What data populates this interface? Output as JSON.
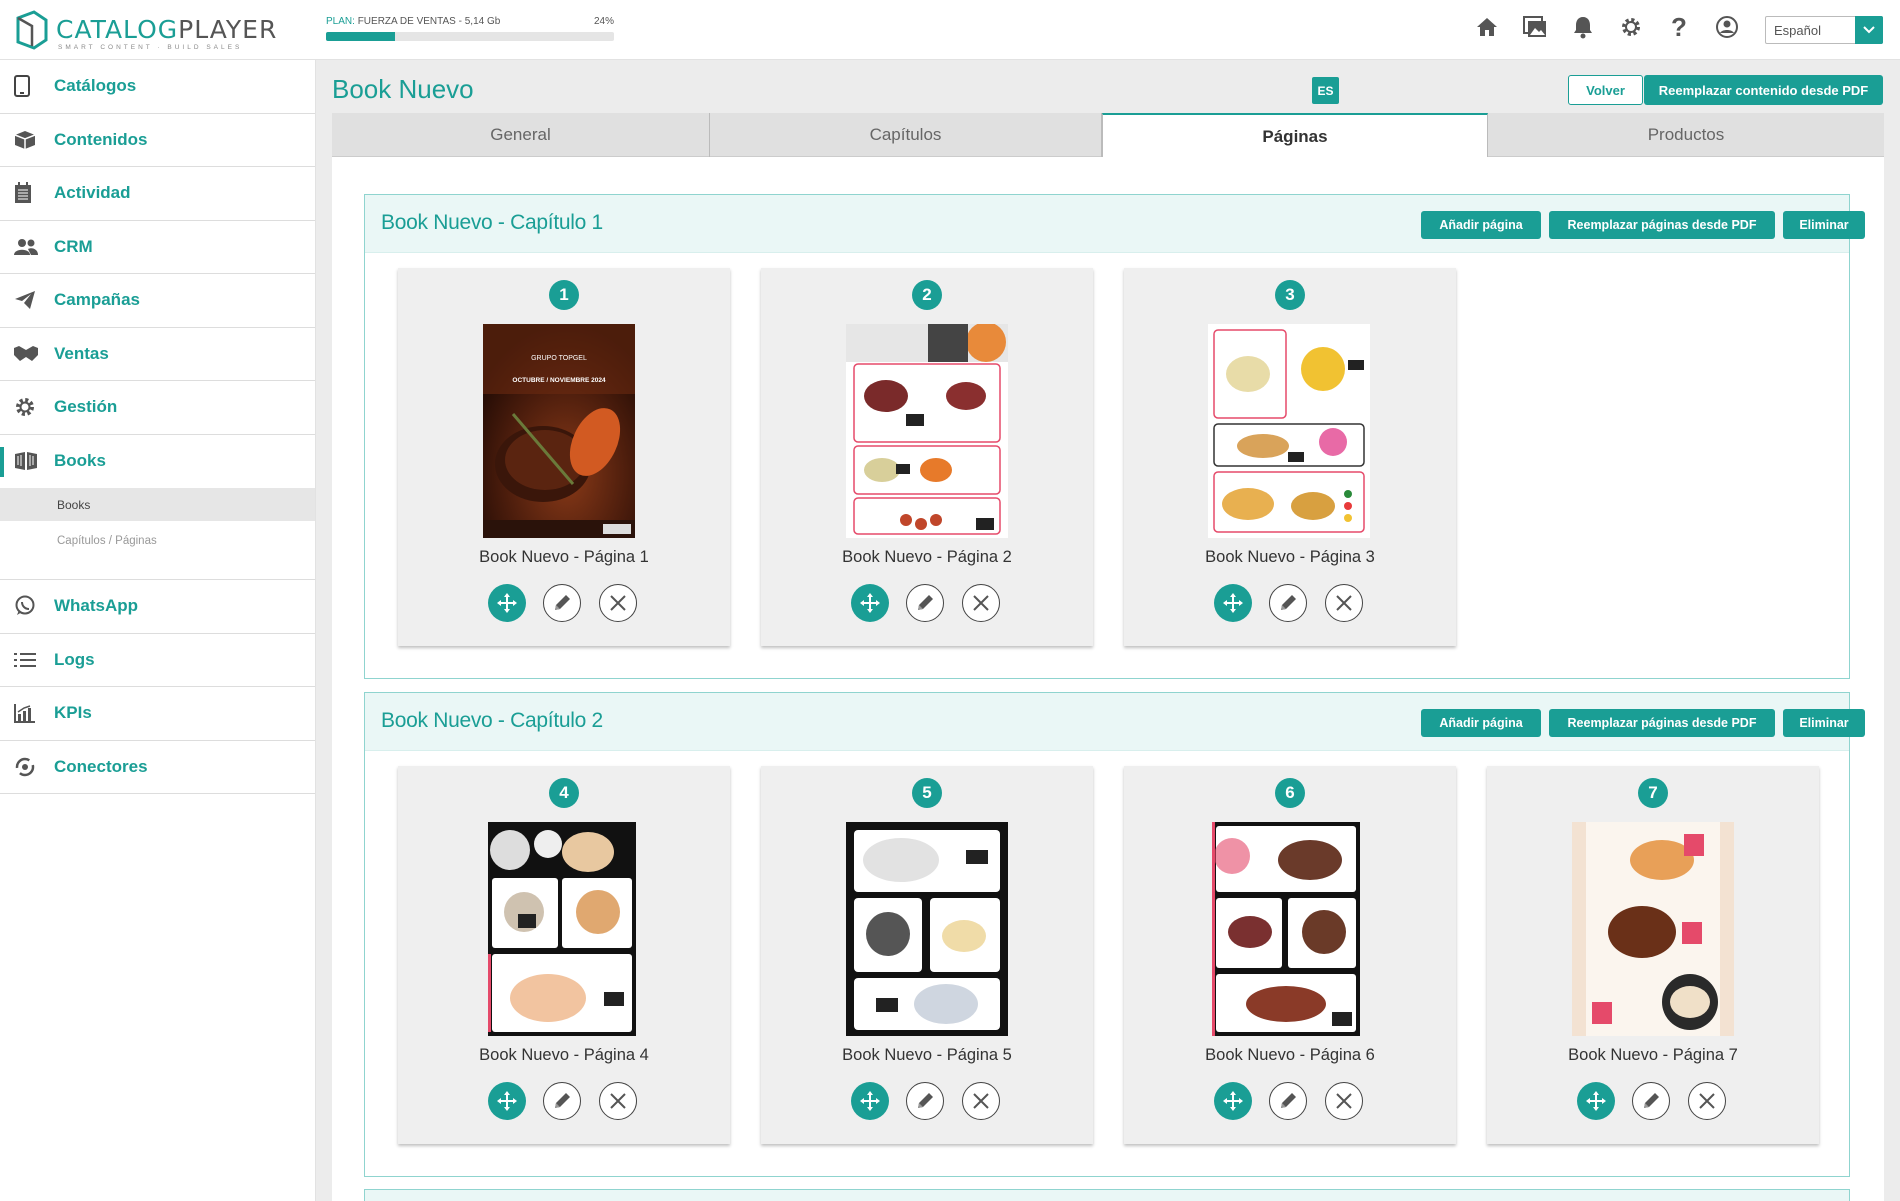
{
  "header": {
    "logo_main": "CATALOG",
    "logo_light": "PLAYER",
    "logo_tagline": "SMART CONTENT · BUILD SALES",
    "plan_prefix": "PLAN:",
    "plan_label": "FUERZA DE VENTAS - 5,14 Gb",
    "plan_percent_label": "24%",
    "plan_percent": 0.24,
    "icons": [
      "home-icon",
      "images-icon",
      "bell-icon",
      "gear-icon",
      "help-icon",
      "user-icon"
    ],
    "language": "Español"
  },
  "sidebar": {
    "items": [
      {
        "label": "Catálogos",
        "icon": "tablet-icon"
      },
      {
        "label": "Contenidos",
        "icon": "boxes-icon"
      },
      {
        "label": "Actividad",
        "icon": "calendar-icon"
      },
      {
        "label": "CRM",
        "icon": "users-icon"
      },
      {
        "label": "Campañas",
        "icon": "paper-plane-icon"
      },
      {
        "label": "Ventas",
        "icon": "handshake-icon"
      },
      {
        "label": "Gestión",
        "icon": "cog-icon"
      },
      {
        "label": "Books",
        "icon": "book-open-icon"
      }
    ],
    "sub_items": [
      "Books",
      "Capítulos / Páginas"
    ],
    "items_after": [
      {
        "label": "WhatsApp",
        "icon": "whatsapp-icon"
      },
      {
        "label": "Logs",
        "icon": "list-icon"
      },
      {
        "label": "KPIs",
        "icon": "chart-icon"
      },
      {
        "label": "Conectores",
        "icon": "connector-icon"
      }
    ]
  },
  "main": {
    "title": "Book Nuevo",
    "lang_badge": "ES",
    "back_label": "Volver",
    "replace_all_label": "Reemplazar contenido desde PDF",
    "tabs": [
      "General",
      "Capítulos",
      "Páginas",
      "Productos"
    ],
    "active_tab": "Páginas",
    "chapter_actions": {
      "add": "Añadir página",
      "replace": "Reemplazar páginas desde PDF",
      "delete": "Eliminar"
    },
    "chapters": [
      {
        "title": "Book Nuevo - Capítulo 1",
        "pages": [
          {
            "number": "1",
            "title": "Book Nuevo - Página 1"
          },
          {
            "number": "2",
            "title": "Book Nuevo - Página 2"
          },
          {
            "number": "3",
            "title": "Book Nuevo - Página 3"
          }
        ]
      },
      {
        "title": "Book Nuevo - Capítulo 2",
        "pages": [
          {
            "number": "4",
            "title": "Book Nuevo - Página 4"
          },
          {
            "number": "5",
            "title": "Book Nuevo - Página 5"
          },
          {
            "number": "6",
            "title": "Book Nuevo - Página 6"
          },
          {
            "number": "7",
            "title": "Book Nuevo - Página 7"
          }
        ]
      }
    ],
    "cover_texts": {
      "brand": "GRUPO TOPGEL",
      "date": "OCTUBRE / NOVIEMBRE 2024"
    }
  },
  "colors": {
    "accent": "#1a9e95",
    "chapter_bg": "#eaf7f6",
    "chapter_border": "#8fd4cf"
  }
}
